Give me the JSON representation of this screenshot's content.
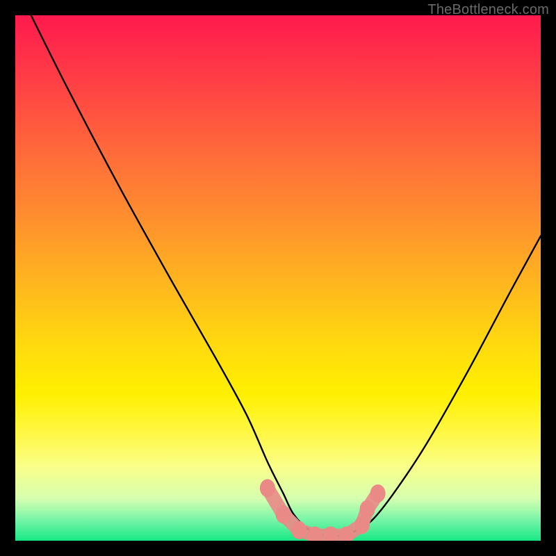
{
  "watermark": "TheBottleneck.com",
  "chart_data": {
    "type": "line",
    "title": "",
    "xlabel": "",
    "ylabel": "",
    "xlim": [
      0,
      100
    ],
    "ylim": [
      0,
      100
    ],
    "series": [
      {
        "name": "bottleneck-curve",
        "x": [
          3,
          10,
          20,
          30,
          38,
          44,
          48,
          51,
          53,
          56,
          59,
          62,
          65,
          68,
          72,
          78,
          86,
          94,
          100
        ],
        "values": [
          100,
          86,
          67,
          49,
          35,
          24,
          15,
          9,
          5,
          2,
          1,
          1,
          2,
          4,
          9,
          18,
          32,
          47,
          58
        ]
      }
    ],
    "markers": {
      "name": "highlighted-points",
      "color": "#e98a87",
      "x": [
        48,
        51,
        54,
        57,
        60,
        63,
        66,
        67,
        69
      ],
      "values": [
        10,
        5,
        2,
        1,
        1,
        1,
        3,
        6,
        9
      ]
    },
    "background_gradient": {
      "stops": [
        {
          "pos": 0,
          "color": "#ff1a4d"
        },
        {
          "pos": 50,
          "color": "#ffb320"
        },
        {
          "pos": 80,
          "color": "#fff84a"
        },
        {
          "pos": 100,
          "color": "#17e886"
        }
      ]
    }
  }
}
